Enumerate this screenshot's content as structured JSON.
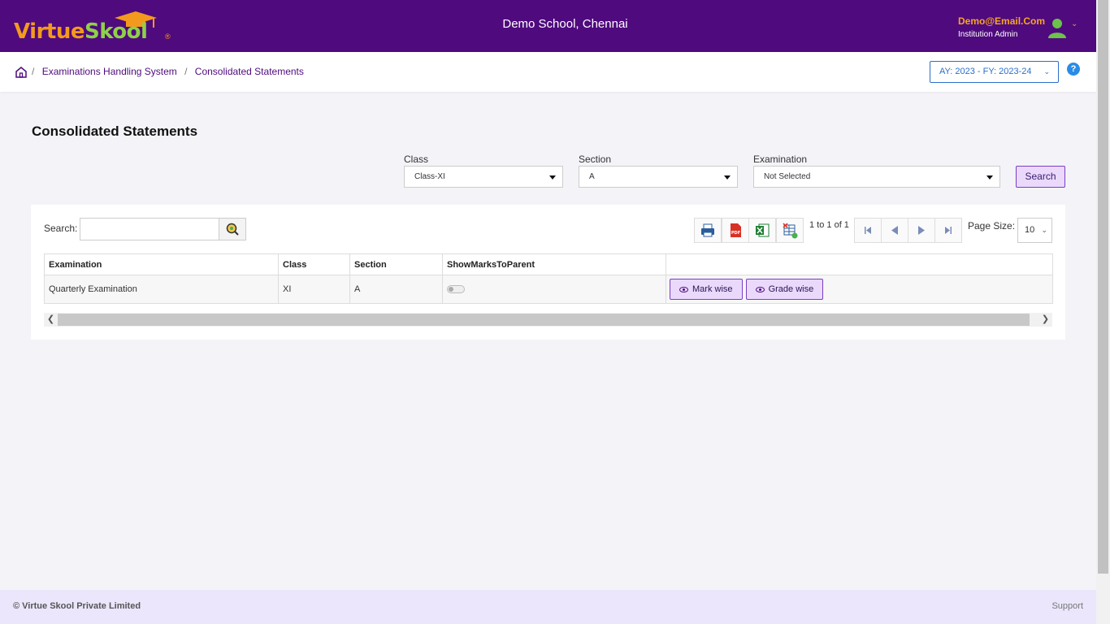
{
  "brand": {
    "logo_part1": "Virtue",
    "logo_part2": "Skool",
    "reg": "®"
  },
  "header": {
    "school_name": "Demo School, Chennai",
    "user_email": "Demo@Email.Com",
    "user_role": "Institution Admin"
  },
  "breadcrumb": {
    "items": [
      "Examinations Handling System",
      "Consolidated Statements"
    ]
  },
  "academic_year": {
    "label": "AY: 2023 - FY: 2023-24"
  },
  "help": {
    "glyph": "?"
  },
  "page": {
    "title": "Consolidated Statements"
  },
  "filters": {
    "class": {
      "label": "Class",
      "value": "Class-XI"
    },
    "section": {
      "label": "Section",
      "value": "A"
    },
    "examination": {
      "label": "Examination",
      "value": "Not Selected"
    },
    "search_button": "Search"
  },
  "grid": {
    "search_label": "Search:",
    "search_value": "",
    "pager_text": "1 to 1 of 1",
    "page_size_label": "Page Size:",
    "page_size_value": "10",
    "columns": [
      "Examination",
      "Class",
      "Section",
      "ShowMarksToParent",
      ""
    ],
    "rows": [
      {
        "examination": "Quarterly Examination",
        "class": "XI",
        "section": "A",
        "show_marks": false
      }
    ],
    "actions": {
      "mark_wise": "Mark wise",
      "grade_wise": "Grade wise"
    }
  },
  "footer": {
    "copyright": "© Virtue Skool Private Limited",
    "support": "Support"
  },
  "colors": {
    "header_bg": "#4f0a7e",
    "accent_orange": "#f39a1e",
    "accent_green": "#8fd04a",
    "link_blue": "#2a6fc9",
    "button_bg": "#ead9fb"
  }
}
